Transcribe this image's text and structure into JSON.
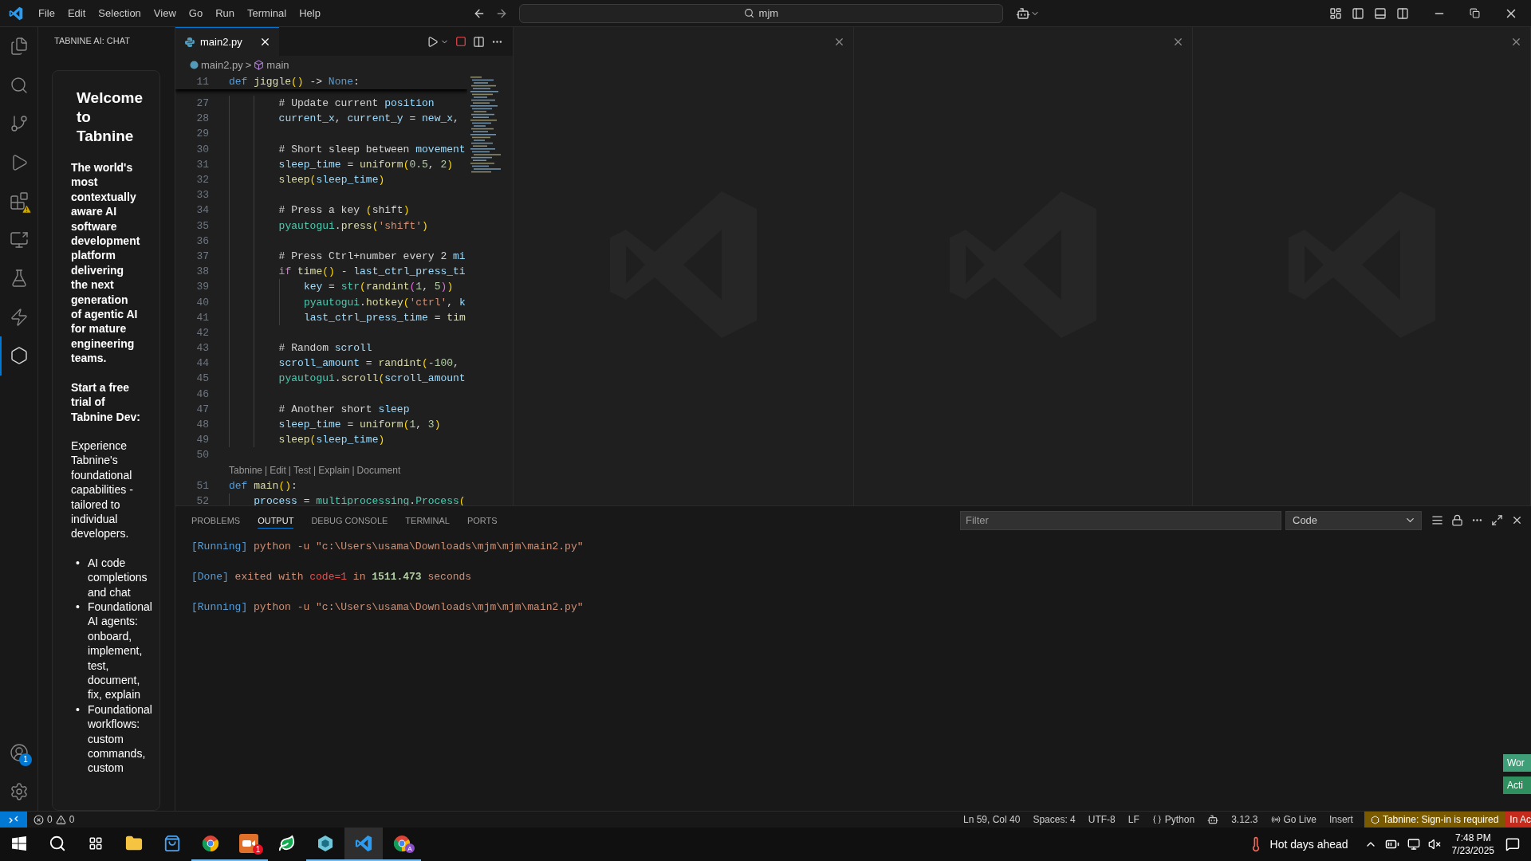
{
  "title_bar": {
    "menu": [
      "File",
      "Edit",
      "Selection",
      "View",
      "Go",
      "Run",
      "Terminal",
      "Help"
    ],
    "search": "mjm"
  },
  "activity_bar": {
    "items": [
      {
        "selected": false
      },
      {
        "selected": false
      },
      {
        "selected": false
      },
      {
        "selected": false
      },
      {
        "selected": false
      },
      {
        "selected": false
      },
      {
        "selected": false
      },
      {
        "selected": false
      },
      {
        "selected": true
      }
    ],
    "account_badge": "1"
  },
  "sidebar": {
    "title": "TABNINE AI: CHAT",
    "heading": "Welcome to Tabnine",
    "intro": "The world's most contextually aware AI software development platform delivering the next generation of agentic AI for mature engineering teams.",
    "cta": "Start a free trial of Tabnine Dev:",
    "description": "Experience Tabnine's foundational capabilities - tailored to individual developers.",
    "bullet_marker": "•",
    "bullets": [
      "AI code completions and chat",
      "Foundational AI agents: onboard, implement, test, document, fix, explain",
      "Foundational workflows: custom commands, custom"
    ]
  },
  "editor": {
    "tab": {
      "label": "main2.py",
      "selected": true
    },
    "breadcrumb": {
      "file": "main2.py",
      "symbol": "main",
      "separator": ">"
    },
    "sticky_line": {
      "number": "11",
      "tokens": [
        {
          "kind": "kw",
          "text": "def"
        },
        {
          "kind": "fn",
          "text": " jiggle"
        },
        {
          "kind": "br",
          "text": "()"
        },
        {
          "kind": "op",
          "text": " -> "
        },
        {
          "kind": "kw",
          "text": "None"
        },
        {
          "kind": "op",
          "text": ":"
        }
      ]
    },
    "lines": [
      {
        "number": "27",
        "kind": "body",
        "tokens": [
          {
            "kind": "cm",
            "text": "# Update current "
          },
          {
            "kind": "var",
            "text": "position"
          }
        ]
      },
      {
        "number": "28",
        "kind": "body",
        "tokens": [
          {
            "kind": "var",
            "text": "current_x"
          },
          {
            "kind": "op",
            "text": ", "
          },
          {
            "kind": "var",
            "text": "current_y"
          },
          {
            "kind": "op",
            "text": " = "
          },
          {
            "kind": "var",
            "text": "new_x"
          },
          {
            "kind": "op",
            "text": ","
          }
        ]
      },
      {
        "number": "29",
        "kind": "body"
      },
      {
        "number": "30",
        "kind": "body",
        "tokens": [
          {
            "kind": "cm",
            "text": "# Short sleep between "
          },
          {
            "kind": "var",
            "text": "movement"
          }
        ]
      },
      {
        "number": "31",
        "kind": "body",
        "tokens": [
          {
            "kind": "var",
            "text": "sleep_time"
          },
          {
            "kind": "op",
            "text": " = "
          },
          {
            "kind": "fn",
            "text": "uniform"
          },
          {
            "kind": "br",
            "text": "("
          },
          {
            "kind": "num",
            "text": "0.5"
          },
          {
            "kind": "op",
            "text": ", "
          },
          {
            "kind": "num",
            "text": "2"
          },
          {
            "kind": "br",
            "text": ")"
          }
        ]
      },
      {
        "number": "32",
        "kind": "body",
        "tokens": [
          {
            "kind": "fn",
            "text": "sleep"
          },
          {
            "kind": "br",
            "text": "("
          },
          {
            "kind": "var",
            "text": "sleep_time"
          },
          {
            "kind": "br",
            "text": ")"
          }
        ]
      },
      {
        "number": "33",
        "kind": "body"
      },
      {
        "number": "34",
        "kind": "body",
        "tokens": [
          {
            "kind": "cm",
            "text": "# Press a key "
          },
          {
            "kind": "br",
            "text": "("
          },
          {
            "kind": "cm",
            "text": "shift"
          },
          {
            "kind": "br",
            "text": ")"
          }
        ]
      },
      {
        "number": "35",
        "kind": "body",
        "tokens": [
          {
            "kind": "mod",
            "text": "pyautogui"
          },
          {
            "kind": "op",
            "text": "."
          },
          {
            "kind": "fn",
            "text": "press"
          },
          {
            "kind": "br",
            "text": "("
          },
          {
            "kind": "str",
            "text": "'shift'"
          },
          {
            "kind": "br",
            "text": ")"
          }
        ]
      },
      {
        "number": "36",
        "kind": "body"
      },
      {
        "number": "37",
        "kind": "body",
        "tokens": [
          {
            "kind": "cm",
            "text": "# Press Ctrl+number every 2 "
          },
          {
            "kind": "var",
            "text": "mi"
          }
        ]
      },
      {
        "number": "38",
        "kind": "body",
        "tokens": [
          {
            "kind": "ctrl",
            "text": "if"
          },
          {
            "kind": "fn",
            "text": " time"
          },
          {
            "kind": "br",
            "text": "()"
          },
          {
            "kind": "op",
            "text": " - "
          },
          {
            "kind": "var",
            "text": "last_ctrl_press_ti"
          }
        ]
      },
      {
        "number": "39",
        "kind": "inner",
        "tokens": [
          {
            "kind": "var",
            "text": "key"
          },
          {
            "kind": "op",
            "text": " = "
          },
          {
            "kind": "mod",
            "text": "str"
          },
          {
            "kind": "br",
            "text": "("
          },
          {
            "kind": "fn",
            "text": "randint"
          },
          {
            "kind": "br2",
            "text": "("
          },
          {
            "kind": "num",
            "text": "1"
          },
          {
            "kind": "op",
            "text": ", "
          },
          {
            "kind": "num",
            "text": "5"
          },
          {
            "kind": "br2",
            "text": ")"
          },
          {
            "kind": "br",
            "text": ")"
          }
        ]
      },
      {
        "number": "40",
        "kind": "inner",
        "tokens": [
          {
            "kind": "mod",
            "text": "pyautogui"
          },
          {
            "kind": "op",
            "text": "."
          },
          {
            "kind": "fn",
            "text": "hotkey"
          },
          {
            "kind": "br",
            "text": "("
          },
          {
            "kind": "str",
            "text": "'ctrl'"
          },
          {
            "kind": "op",
            "text": ", "
          },
          {
            "kind": "var",
            "text": "k"
          }
        ]
      },
      {
        "number": "41",
        "kind": "inner",
        "tokens": [
          {
            "kind": "var",
            "text": "last_ctrl_press_time"
          },
          {
            "kind": "op",
            "text": " = "
          },
          {
            "kind": "fn",
            "text": "tim"
          }
        ]
      },
      {
        "number": "42",
        "kind": "body"
      },
      {
        "number": "43",
        "kind": "body",
        "tokens": [
          {
            "kind": "cm",
            "text": "# Random "
          },
          {
            "kind": "var",
            "text": "scroll"
          }
        ]
      },
      {
        "number": "44",
        "kind": "body",
        "tokens": [
          {
            "kind": "var",
            "text": "scroll_amount"
          },
          {
            "kind": "op",
            "text": " = "
          },
          {
            "kind": "fn",
            "text": "randint"
          },
          {
            "kind": "br",
            "text": "("
          },
          {
            "kind": "op",
            "text": "-"
          },
          {
            "kind": "num",
            "text": "100"
          },
          {
            "kind": "op",
            "text": ","
          }
        ]
      },
      {
        "number": "45",
        "kind": "body",
        "tokens": [
          {
            "kind": "mod",
            "text": "pyautogui"
          },
          {
            "kind": "op",
            "text": "."
          },
          {
            "kind": "fn",
            "text": "scroll"
          },
          {
            "kind": "br",
            "text": "("
          },
          {
            "kind": "var",
            "text": "scroll_amount"
          }
        ]
      },
      {
        "number": "46",
        "kind": "body"
      },
      {
        "number": "47",
        "kind": "body",
        "tokens": [
          {
            "kind": "cm",
            "text": "# Another short "
          },
          {
            "kind": "var",
            "text": "sleep"
          }
        ]
      },
      {
        "number": "48",
        "kind": "body",
        "tokens": [
          {
            "kind": "var",
            "text": "sleep_time"
          },
          {
            "kind": "op",
            "text": " = "
          },
          {
            "kind": "fn",
            "text": "uniform"
          },
          {
            "kind": "br",
            "text": "("
          },
          {
            "kind": "num",
            "text": "1"
          },
          {
            "kind": "op",
            "text": ", "
          },
          {
            "kind": "num",
            "text": "3"
          },
          {
            "kind": "br",
            "text": ")"
          }
        ]
      },
      {
        "number": "49",
        "kind": "body",
        "tokens": [
          {
            "kind": "fn",
            "text": "sleep"
          },
          {
            "kind": "br",
            "text": "("
          },
          {
            "kind": "var",
            "text": "sleep_time"
          },
          {
            "kind": "br",
            "text": ")"
          }
        ]
      },
      {
        "number": "50",
        "kind": "top"
      }
    ],
    "codelens": {
      "items": [
        "Tabnine",
        "Edit",
        "Test",
        "Explain",
        "Document"
      ],
      "separator": "|"
    },
    "after_lines": [
      {
        "number": "51",
        "kind": "top",
        "tokens": [
          {
            "kind": "kw",
            "text": "def"
          },
          {
            "kind": "fn",
            "text": " main"
          },
          {
            "kind": "br",
            "text": "()"
          },
          {
            "kind": "op",
            "text": ":"
          }
        ]
      },
      {
        "number": "52",
        "kind": "block",
        "tokens": [
          {
            "kind": "var",
            "text": "process"
          },
          {
            "kind": "op",
            "text": " = "
          },
          {
            "kind": "mod",
            "text": "multiprocessing"
          },
          {
            "kind": "op",
            "text": "."
          },
          {
            "kind": "mod",
            "text": "Process"
          },
          {
            "kind": "br",
            "text": "("
          }
        ]
      }
    ]
  },
  "panel": {
    "tabs": [
      {
        "label": "PROBLEMS",
        "selected": false
      },
      {
        "label": "OUTPUT",
        "selected": true
      },
      {
        "label": "DEBUG CONSOLE",
        "selected": false
      },
      {
        "label": "TERMINAL",
        "selected": false
      },
      {
        "label": "PORTS",
        "selected": false
      }
    ],
    "filter_placeholder": "Filter",
    "channel": "Code",
    "output": [
      {
        "tokens": [
          {
            "kind": "tag",
            "text": "[Running]"
          },
          {
            "kind": "out",
            "text": " python -u \"c:\\Users\\usama\\Downloads\\mjm\\mjm\\main2.py\""
          }
        ]
      },
      {
        "tokens": [
          {
            "kind": "tag",
            "text": "[Done]"
          },
          {
            "kind": "out",
            "text": " exited with "
          },
          {
            "kind": "err",
            "text": "code=1"
          },
          {
            "kind": "out",
            "text": " in "
          },
          {
            "kind": "bold",
            "text": "1511.473"
          },
          {
            "kind": "out",
            "text": " seconds"
          }
        ]
      },
      {
        "tokens": [
          {
            "kind": "tag",
            "text": "[Running]"
          },
          {
            "kind": "out",
            "text": " python -u \"c:\\Users\\usama\\Downloads\\mjm\\mjm\\main2.py\""
          }
        ]
      }
    ]
  },
  "status_bar": {
    "errors": "0",
    "warnings": "0",
    "position": "Ln 59, Col 40",
    "spaces": "Spaces: 4",
    "encoding": "UTF-8",
    "eol": "LF",
    "language": "Python",
    "python_version": "3.12.3",
    "live": "Go Live",
    "mode": "Insert",
    "tabnine": "Tabnine: Sign-in is required",
    "cut_item": "In Ac"
  },
  "notifications": [
    {
      "text": "Wor",
      "color": "#3f9f78"
    },
    {
      "text": "Acti",
      "color": "#2f8f5f"
    }
  ],
  "taskbar": {
    "apps": [
      {
        "open": false,
        "selected": false
      },
      {
        "open": false,
        "selected": false
      },
      {
        "open": true,
        "selected": false
      },
      {
        "open": true,
        "selected": false,
        "badge": "1"
      },
      {
        "open": false,
        "selected": false
      },
      {
        "open": true,
        "selected": false
      },
      {
        "open": true,
        "selected": true
      },
      {
        "open": true,
        "selected": false,
        "profile": "A"
      }
    ],
    "weather": "Hot days ahead",
    "time": "7:48 PM",
    "date": "7/23/2025"
  }
}
